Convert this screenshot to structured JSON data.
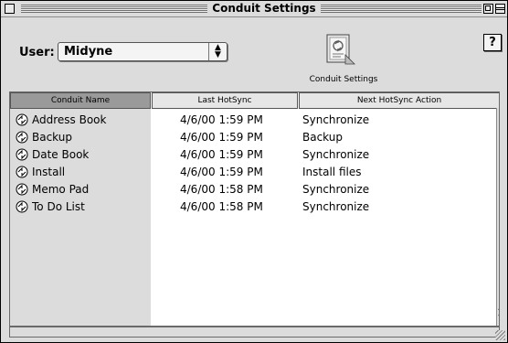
{
  "window": {
    "title": "Conduit Settings"
  },
  "user": {
    "label": "User:",
    "selected": "Midyne"
  },
  "conduit_icon": {
    "label": "Conduit Settings"
  },
  "help": {
    "label": "?"
  },
  "columns": [
    "Conduit Name",
    "Last HotSync",
    "Next HotSync Action"
  ],
  "rows": [
    {
      "name": "Address Book",
      "last": "4/6/00 1:59 PM",
      "action": "Synchronize"
    },
    {
      "name": "Backup",
      "last": "4/6/00 1:59 PM",
      "action": "Backup"
    },
    {
      "name": "Date Book",
      "last": "4/6/00 1:59 PM",
      "action": "Synchronize"
    },
    {
      "name": "Install",
      "last": "4/6/00 1:59 PM",
      "action": "Install files"
    },
    {
      "name": "Memo Pad",
      "last": "4/6/00 1:58 PM",
      "action": "Synchronize"
    },
    {
      "name": "To Do List",
      "last": "4/6/00 1:58 PM",
      "action": "Synchronize"
    }
  ],
  "icons": {
    "row": "hotsync-icon",
    "window": "conduit-settings-icon"
  }
}
